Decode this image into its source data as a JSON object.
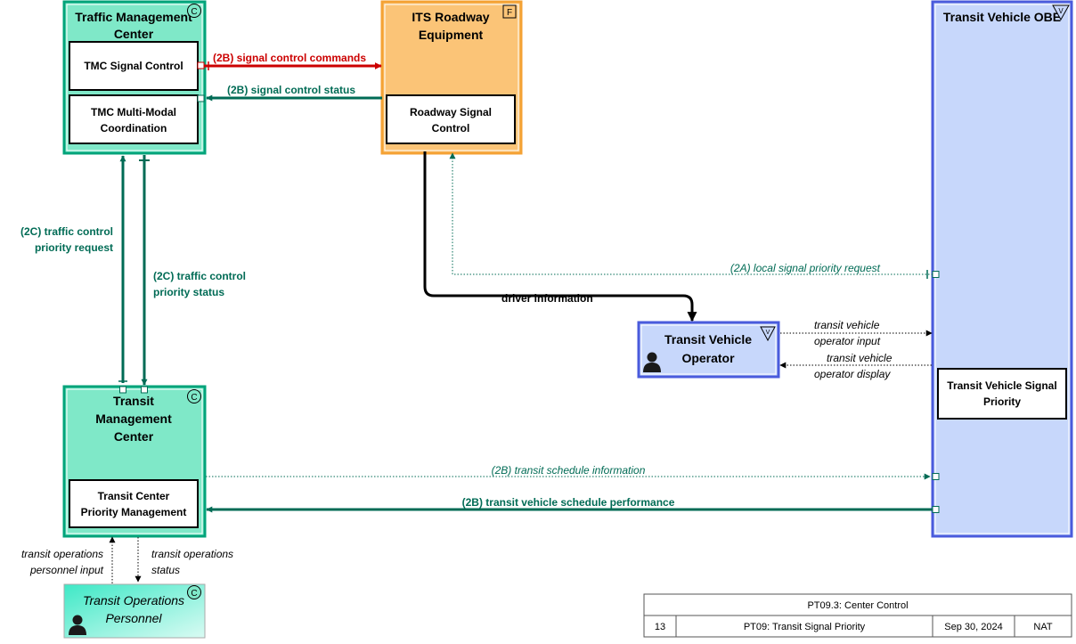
{
  "colors": {
    "center_fill": "#7fe8c8",
    "center_stroke": "#00a37a",
    "field_fill": "#fbc477",
    "field_stroke": "#f4a234",
    "vehicle_fill": "#c7d7fb",
    "vehicle_stroke": "#4a5bdc",
    "teal_flow": "#006b55",
    "red_flow": "#cc0000"
  },
  "elements": {
    "tmc": {
      "title_line1": "Traffic Management",
      "title_line2": "Center",
      "type_badge": "C"
    },
    "tmc_signal_control": {
      "line1": "TMC Signal Control"
    },
    "tmc_multimodal": {
      "line1": "TMC Multi-Modal",
      "line2": "Coordination"
    },
    "its_roadway": {
      "title_line1": "ITS Roadway",
      "title_line2": "Equipment",
      "type_badge": "F"
    },
    "roadway_signal_control": {
      "line1": "Roadway Signal",
      "line2": "Control"
    },
    "transit_obe": {
      "title": "Transit Vehicle OBE",
      "type_badge": "V"
    },
    "tv_signal_priority": {
      "line1": "Transit Vehicle Signal",
      "line2": "Priority"
    },
    "tv_operator": {
      "line1": "Transit Vehicle",
      "line2": "Operator",
      "type_badge": "V"
    },
    "tmc_transit": {
      "title_line1": "Transit",
      "title_line2": "Management",
      "title_line3": "Center",
      "type_badge": "C"
    },
    "transit_center_priority": {
      "line1": "Transit Center",
      "line2": "Priority Management"
    },
    "transit_ops_personnel": {
      "line1": "Transit Operations",
      "line2": "Personnel",
      "type_badge": "C"
    }
  },
  "flows": {
    "signal_control_commands": "(2B) signal control commands",
    "signal_control_status": "(2B) signal control status",
    "tc_priority_request_l1": "(2C) traffic control",
    "tc_priority_request_l2": "priority request",
    "tc_priority_status_l1": "(2C) traffic control",
    "tc_priority_status_l2": "priority status",
    "local_signal_priority_request": "(2A) local signal priority request",
    "driver_information": "driver information",
    "tv_operator_input_l1": "transit vehicle",
    "tv_operator_input_l2": "operator input",
    "tv_operator_display_l1": "transit vehicle",
    "tv_operator_display_l2": "operator display",
    "transit_schedule_information": "(2B) transit schedule information",
    "transit_vehicle_schedule_performance": "(2B) transit vehicle schedule performance",
    "transit_ops_personnel_input_l1": "transit operations",
    "transit_ops_personnel_input_l2": "personnel input",
    "transit_ops_status_l1": "transit operations",
    "transit_ops_status_l2": "status"
  },
  "title_block": {
    "title": "PT09.3: Center Control",
    "number": "13",
    "service": "PT09: Transit Signal Priority",
    "date": "Sep 30, 2024",
    "scope": "NAT"
  }
}
